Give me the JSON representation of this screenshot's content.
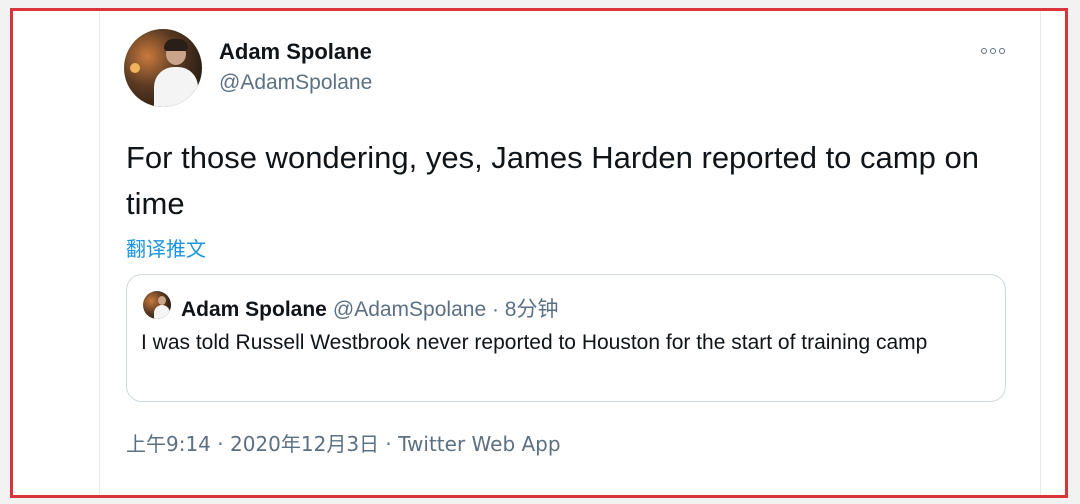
{
  "author": {
    "name": "Adam Spolane",
    "handle": "@AdamSpolane"
  },
  "tweet": {
    "text": "For those wondering, yes, James Harden reported to camp on time",
    "translate_label": "翻译推文"
  },
  "quoted_tweet": {
    "name": "Adam Spolane",
    "meta": "@AdamSpolane · 8分钟",
    "text": "I was told Russell Westbrook never reported to Houston for the start of training camp"
  },
  "footer": {
    "timestamp": "上午9:14 · 2020年12月3日 · ",
    "source": "Twitter Web App"
  },
  "icons": {
    "more": "more-options-icon"
  },
  "colors": {
    "frame_border": "#d9343a",
    "link": "#1b95e0",
    "secondary_text": "#5b7083"
  }
}
